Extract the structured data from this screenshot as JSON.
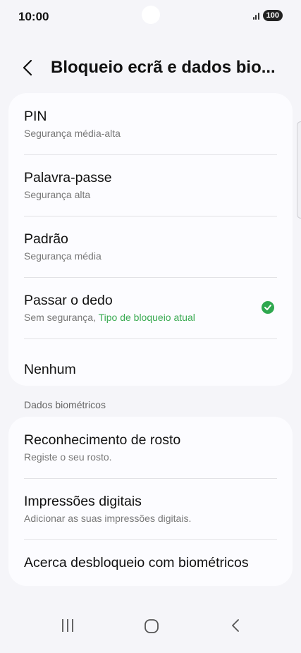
{
  "status_bar": {
    "time": "10:00",
    "battery": "100",
    "icons": [
      "signal-icon",
      "battery-icon"
    ]
  },
  "header": {
    "title": "Bloqueio ecrã e dados bio..."
  },
  "lock_types": [
    {
      "title": "PIN",
      "subtitle": "Segurança média-alta"
    },
    {
      "title": "Palavra-passe",
      "subtitle": "Segurança alta"
    },
    {
      "title": "Padrão",
      "subtitle": "Segurança média"
    },
    {
      "title": "Passar o dedo",
      "subtitle": "Sem segurança, ",
      "subtitle_highlight": "Tipo de bloqueio atual",
      "selected": true
    },
    {
      "title": "Nenhum"
    }
  ],
  "biometrics": {
    "section_label": "Dados biométricos",
    "items": [
      {
        "title": "Reconhecimento de rosto",
        "subtitle": "Registe o seu rosto."
      },
      {
        "title": "Impressões digitais",
        "subtitle": "Adicionar as suas impressões digitais."
      },
      {
        "title": "Acerca desbloqueio com biométricos"
      }
    ]
  },
  "colors": {
    "accent_green": "#3aaa52",
    "background": "#f5f5f9",
    "card": "#fcfcff"
  },
  "nav_bar": {
    "icons": [
      "recents-icon",
      "home-icon",
      "back-icon"
    ]
  }
}
